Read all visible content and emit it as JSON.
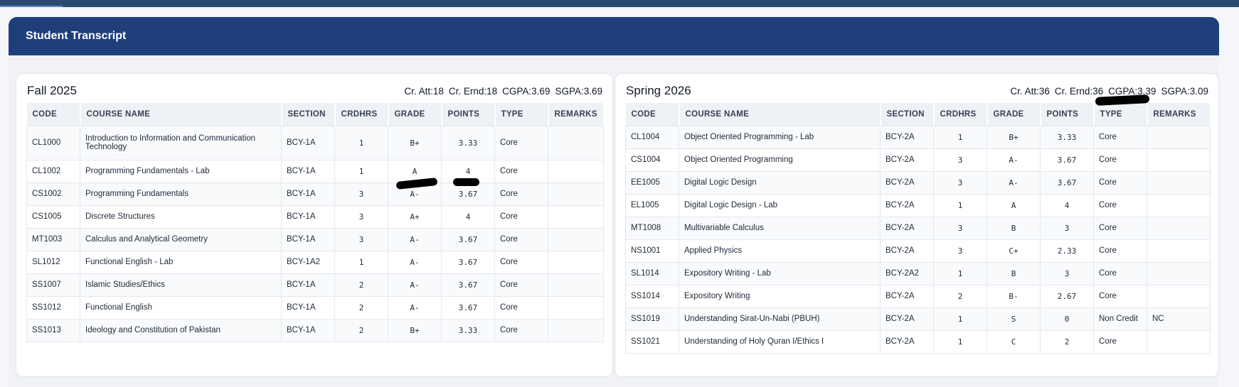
{
  "page": {
    "title": "Student Transcript"
  },
  "columns": [
    "CODE",
    "COURSE NAME",
    "SECTION",
    "CRDHRS",
    "GRADE",
    "POINTS",
    "TYPE",
    "REMARKS"
  ],
  "semesters": [
    {
      "name": "Fall 2025",
      "stats": {
        "cr_att": "Cr. Att:18",
        "cr_ernd": "Cr. Ernd:18",
        "cgpa": "CGPA:3.69",
        "sgpa": "SGPA:3.69"
      },
      "rows": [
        {
          "code": "CL1000",
          "name": "Introduction to Information and Communication Technology",
          "section": "BCY-1A",
          "crdhrs": "1",
          "grade": "B+",
          "points": "3.33",
          "type": "Core",
          "remarks": ""
        },
        {
          "code": "CL1002",
          "name": "Programming Fundamentals - Lab",
          "section": "BCY-1A",
          "crdhrs": "1",
          "grade": "A",
          "points": "4",
          "type": "Core",
          "remarks": ""
        },
        {
          "code": "CS1002",
          "name": "Programming Fundamentals",
          "section": "BCY-1A",
          "crdhrs": "3",
          "grade": "A-",
          "points": "3.67",
          "type": "Core",
          "remarks": ""
        },
        {
          "code": "CS1005",
          "name": "Discrete Structures",
          "section": "BCY-1A",
          "crdhrs": "3",
          "grade": "A+",
          "points": "4",
          "type": "Core",
          "remarks": ""
        },
        {
          "code": "MT1003",
          "name": "Calculus and Analytical Geometry",
          "section": "BCY-1A",
          "crdhrs": "3",
          "grade": "A-",
          "points": "3.67",
          "type": "Core",
          "remarks": ""
        },
        {
          "code": "SL1012",
          "name": "Functional English - Lab",
          "section": "BCY-1A2",
          "crdhrs": "1",
          "grade": "A-",
          "points": "3.67",
          "type": "Core",
          "remarks": ""
        },
        {
          "code": "SS1007",
          "name": "Islamic Studies/Ethics",
          "section": "BCY-1A",
          "crdhrs": "2",
          "grade": "A-",
          "points": "3.67",
          "type": "Core",
          "remarks": ""
        },
        {
          "code": "SS1012",
          "name": "Functional English",
          "section": "BCY-1A",
          "crdhrs": "2",
          "grade": "A-",
          "points": "3.67",
          "type": "Core",
          "remarks": ""
        },
        {
          "code": "SS1013",
          "name": "Ideology and Constitution of Pakistan",
          "section": "BCY-1A",
          "crdhrs": "2",
          "grade": "B+",
          "points": "3.33",
          "type": "Core",
          "remarks": ""
        }
      ]
    },
    {
      "name": "Spring 2026",
      "stats": {
        "cr_att": "Cr. Att:36",
        "cr_ernd": "Cr. Ernd:36",
        "cgpa": "CGPA:3.39",
        "sgpa": "SGPA:3.09"
      },
      "rows": [
        {
          "code": "CL1004",
          "name": "Object Oriented Programming - Lab",
          "section": "BCY-2A",
          "crdhrs": "1",
          "grade": "B+",
          "points": "3.33",
          "type": "Core",
          "remarks": ""
        },
        {
          "code": "CS1004",
          "name": "Object Oriented Programming",
          "section": "BCY-2A",
          "crdhrs": "3",
          "grade": "A-",
          "points": "3.67",
          "type": "Core",
          "remarks": ""
        },
        {
          "code": "EE1005",
          "name": "Digital Logic Design",
          "section": "BCY-2A",
          "crdhrs": "3",
          "grade": "A-",
          "points": "3.67",
          "type": "Core",
          "remarks": ""
        },
        {
          "code": "EL1005",
          "name": "Digital Logic Design - Lab",
          "section": "BCY-2A",
          "crdhrs": "1",
          "grade": "A",
          "points": "4",
          "type": "Core",
          "remarks": ""
        },
        {
          "code": "MT1008",
          "name": "Multivariable Calculus",
          "section": "BCY-2A",
          "crdhrs": "3",
          "grade": "B",
          "points": "3",
          "type": "Core",
          "remarks": ""
        },
        {
          "code": "NS1001",
          "name": "Applied Physics",
          "section": "BCY-2A",
          "crdhrs": "3",
          "grade": "C+",
          "points": "2.33",
          "type": "Core",
          "remarks": ""
        },
        {
          "code": "SL1014",
          "name": "Expository Writing - Lab",
          "section": "BCY-2A2",
          "crdhrs": "1",
          "grade": "B",
          "points": "3",
          "type": "Core",
          "remarks": ""
        },
        {
          "code": "SS1014",
          "name": "Expository Writing",
          "section": "BCY-2A",
          "crdhrs": "2",
          "grade": "B-",
          "points": "2.67",
          "type": "Core",
          "remarks": ""
        },
        {
          "code": "SS1019",
          "name": "Understanding Sirat-Un-Nabi (PBUH)",
          "section": "BCY-2A",
          "crdhrs": "1",
          "grade": "S",
          "points": "0",
          "type": "Non Credit",
          "remarks": "NC"
        },
        {
          "code": "SS1021",
          "name": "Understanding of Holy Quran I/Ethics I",
          "section": "BCY-2A",
          "crdhrs": "1",
          "grade": "C",
          "points": "2",
          "type": "Core",
          "remarks": ""
        }
      ]
    }
  ]
}
